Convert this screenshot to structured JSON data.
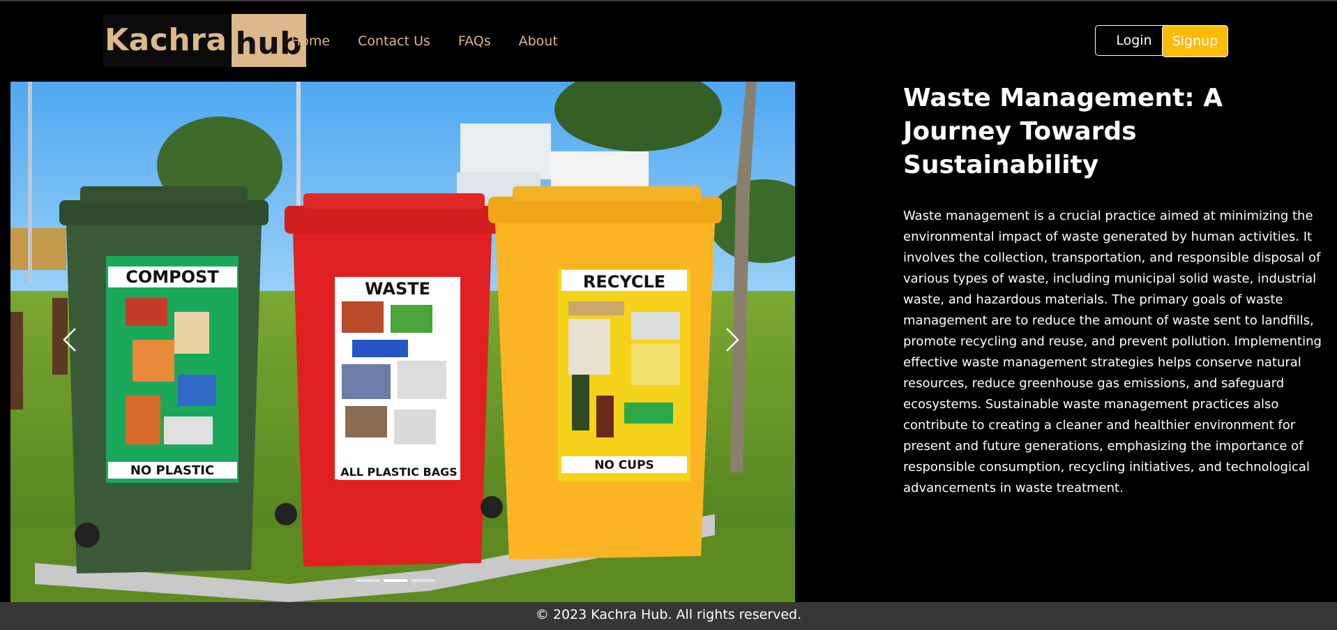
{
  "brand": {
    "part1": "Kachra",
    "part2": "hub"
  },
  "nav": {
    "links": [
      {
        "label": "Home"
      },
      {
        "label": "Contact Us"
      },
      {
        "label": "FAQs"
      },
      {
        "label": "About"
      }
    ],
    "login_label": "Login",
    "signup_label": "Signup"
  },
  "carousel": {
    "slide": {
      "bins": [
        {
          "top_label": "COMPOST",
          "bottom_label": "NO PLASTIC"
        },
        {
          "top_label": "WASTE",
          "bottom_label": "ALL PLASTIC BAGS"
        },
        {
          "top_label": "RECYCLE",
          "bottom_label": "NO CUPS"
        }
      ]
    },
    "indicator_count": 3,
    "active_index": 1
  },
  "article": {
    "title": "Waste Management: A Journey Towards Sustainability",
    "body": "Waste management is a crucial practice aimed at minimizing the environmental impact of waste generated by human activities. It involves the collection, transportation, and responsible disposal of various types of waste, including municipal solid waste, industrial waste, and hazardous materials. The primary goals of waste management are to reduce the amount of waste sent to landfills, promote recycling and reuse, and prevent pollution. Implementing effective waste management strategies helps conserve natural resources, reduce greenhouse gas emissions, and safeguard ecosystems. Sustainable waste management practices also contribute to creating a cleaner and healthier environment for present and future generations, emphasizing the importance of responsible consumption, recycling initiatives, and technological advancements in waste treatment."
  },
  "footer": {
    "text": "© 2023 Kachra Hub. All rights reserved."
  },
  "colors": {
    "accent": "#dcb88a",
    "signup": "#fdbb0a",
    "footer_bg": "#363636"
  }
}
